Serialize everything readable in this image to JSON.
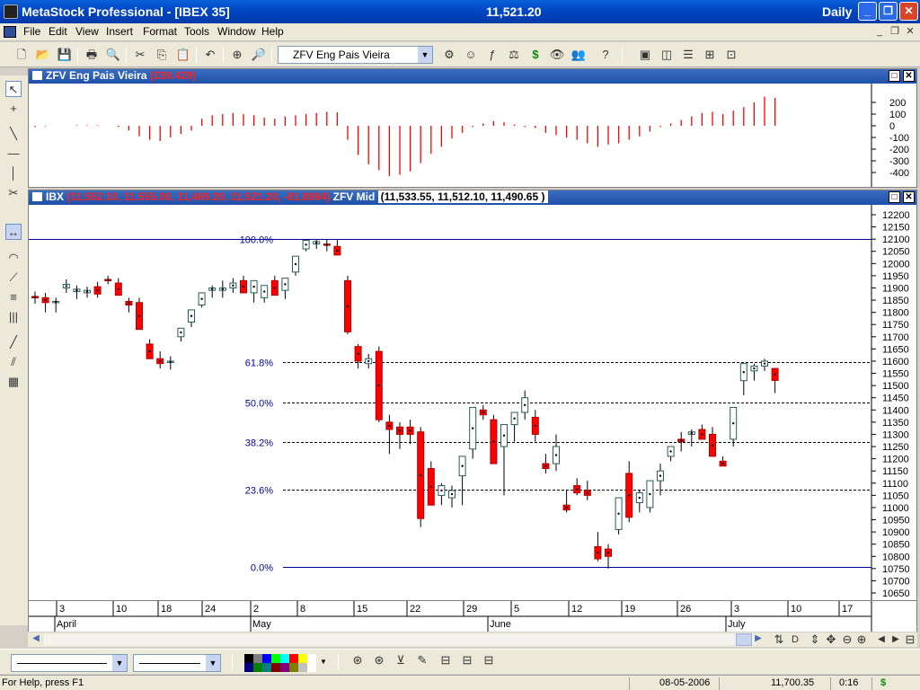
{
  "window": {
    "title": "MetaStock Professional - [IBEX 35]",
    "center_value": "11,521.20",
    "period": "Daily",
    "btn_minimize": "_",
    "btn_restore": "❐",
    "btn_close": "✕"
  },
  "menu": {
    "items": [
      "File",
      "Edit",
      "View",
      "Insert",
      "Format",
      "Tools",
      "Window",
      "Help"
    ],
    "mdi_min": "_",
    "mdi_restore": "❐",
    "mdi_close": "✕"
  },
  "toolbar": {
    "indicator_select": "ZFV Eng Pais Vieira"
  },
  "indicator_pane": {
    "name": "ZFV Eng Pais Vieira",
    "value": "(239.429)",
    "y_ticks": [
      200,
      100,
      0,
      -100,
      -200,
      -300,
      -400
    ],
    "color": "#ff0000"
  },
  "price_pane": {
    "symbol": "IBX",
    "ohlc_text": "(11,552.10, 11,555.00, 11,469.20, 11,521.20, -81.8994)",
    "overlay_name": "ZFV Mid",
    "overlay_values": "(11,533.55, 11,512.10, 11,490.65 )",
    "y_ticks": [
      12200,
      12150,
      12100,
      12050,
      12000,
      11950,
      11900,
      11850,
      11800,
      11750,
      11700,
      11650,
      11600,
      11550,
      11500,
      11450,
      11400,
      11350,
      11300,
      11250,
      11200,
      11150,
      11100,
      11050,
      11000,
      10950,
      10900,
      10850,
      10800,
      10750,
      10700,
      10650
    ],
    "fib_levels": [
      {
        "label": "100.0%",
        "price": 12100,
        "style": "solid"
      },
      {
        "label": "61.8%",
        "price": 11595,
        "style": "dashed"
      },
      {
        "label": "50.0%",
        "price": 11430,
        "style": "dashed"
      },
      {
        "label": "38.2%",
        "price": 11270,
        "style": "dashed"
      },
      {
        "label": "23.6%",
        "price": 11075,
        "style": "dashed"
      },
      {
        "label": "0.0%",
        "price": 10755,
        "style": "solid"
      }
    ],
    "up_color": "#ffffff",
    "down_color": "#ff0000",
    "line_color": "#0000a0"
  },
  "x_axis": {
    "days": [
      "3",
      "10",
      "18",
      "24",
      "2",
      "8",
      "15",
      "22",
      "29",
      "5",
      "12",
      "19",
      "26",
      "3",
      "10",
      "17"
    ],
    "months": [
      "April",
      "May",
      "June",
      "July"
    ]
  },
  "chart_data": {
    "type": "candlestick",
    "series": [
      {
        "name": "IBX",
        "values": [
          [
            11865,
            11885,
            11835,
            11860
          ],
          [
            11860,
            11880,
            11800,
            11840
          ],
          [
            11840,
            11860,
            11800,
            11845
          ],
          [
            11900,
            11935,
            11880,
            11915
          ],
          [
            11885,
            11910,
            11855,
            11895
          ],
          [
            11880,
            11905,
            11860,
            11890
          ],
          [
            11905,
            11925,
            11860,
            11875
          ],
          [
            11935,
            11950,
            11915,
            11930
          ],
          [
            11920,
            11940,
            11880,
            11870
          ],
          [
            11845,
            11860,
            11800,
            11830
          ],
          [
            11840,
            11860,
            11780,
            11730
          ],
          [
            11670,
            11690,
            11610,
            11610
          ],
          [
            11610,
            11640,
            11570,
            11590
          ],
          [
            11595,
            11620,
            11565,
            11600
          ],
          [
            11700,
            11720,
            11680,
            11735
          ],
          [
            11760,
            11790,
            11740,
            11810
          ],
          [
            11830,
            11850,
            11820,
            11880
          ],
          [
            11890,
            11910,
            11860,
            11900
          ],
          [
            11890,
            11930,
            11860,
            11900
          ],
          [
            11900,
            11940,
            11880,
            11920
          ],
          [
            11930,
            11950,
            11890,
            11880
          ],
          [
            11880,
            11900,
            11840,
            11930
          ],
          [
            11860,
            11890,
            11840,
            11910
          ],
          [
            11930,
            11950,
            11880,
            11870
          ],
          [
            11890,
            11910,
            11855,
            11940
          ],
          [
            11965,
            11990,
            11950,
            12030
          ],
          [
            12060,
            12080,
            12050,
            12095
          ],
          [
            12080,
            12100,
            12060,
            12090
          ],
          [
            12080,
            12100,
            12050,
            12075
          ],
          [
            12070,
            12100,
            12040,
            12035
          ],
          [
            11930,
            11950,
            11710,
            11720
          ],
          [
            11660,
            11670,
            11570,
            11600
          ],
          [
            11590,
            11630,
            11570,
            11610
          ],
          [
            11640,
            11660,
            11350,
            11360
          ],
          [
            11350,
            11380,
            11220,
            11320
          ],
          [
            11330,
            11350,
            11240,
            11300
          ],
          [
            11330,
            11360,
            11260,
            11300
          ],
          [
            11310,
            11330,
            10920,
            10955
          ],
          [
            11160,
            11190,
            11010,
            11010
          ],
          [
            11050,
            11100,
            11010,
            11090
          ],
          [
            11040,
            11090,
            11000,
            11070
          ],
          [
            11130,
            11160,
            11010,
            11210
          ],
          [
            11240,
            11270,
            11200,
            11410
          ],
          [
            11400,
            11420,
            11360,
            11380
          ],
          [
            11360,
            11380,
            11200,
            11180
          ],
          [
            11250,
            11300,
            11050,
            11340
          ],
          [
            11340,
            11380,
            11270,
            11390
          ],
          [
            11390,
            11480,
            11360,
            11450
          ],
          [
            11370,
            11400,
            11270,
            11300
          ],
          [
            11180,
            11220,
            11140,
            11160
          ],
          [
            11180,
            11300,
            11150,
            11250
          ],
          [
            11010,
            11070,
            10980,
            10990
          ],
          [
            11090,
            11120,
            11050,
            11060
          ],
          [
            11070,
            11110,
            11030,
            11050
          ],
          [
            10840,
            10900,
            10780,
            10790
          ],
          [
            10830,
            10850,
            10750,
            10800
          ],
          [
            10910,
            10940,
            10890,
            11040
          ],
          [
            11140,
            11190,
            10940,
            10960
          ],
          [
            11020,
            11070,
            10980,
            11060
          ],
          [
            11000,
            11090,
            10980,
            11110
          ],
          [
            11110,
            11180,
            11050,
            11150
          ],
          [
            11210,
            11240,
            11190,
            11250
          ],
          [
            11280,
            11310,
            11230,
            11270
          ],
          [
            11300,
            11320,
            11250,
            11310
          ],
          [
            11320,
            11340,
            11280,
            11280
          ],
          [
            11300,
            11330,
            11210,
            11210
          ],
          [
            11190,
            11210,
            11180,
            11170
          ],
          [
            11280,
            11350,
            11250,
            11410
          ],
          [
            11520,
            11560,
            11460,
            11590
          ],
          [
            11560,
            11590,
            11520,
            11580
          ],
          [
            11580,
            11610,
            11560,
            11600
          ],
          [
            11570,
            11555,
            11469,
            11521
          ]
        ]
      },
      {
        "name": "ZFV Eng Pais Vieira",
        "values": [
          -10,
          -5,
          0,
          0,
          5,
          5,
          5,
          0,
          -10,
          -40,
          -90,
          -120,
          -130,
          -100,
          -70,
          -40,
          60,
          90,
          100,
          110,
          100,
          90,
          70,
          60,
          80,
          90,
          100,
          110,
          120,
          115,
          -120,
          -250,
          -330,
          -380,
          -430,
          -420,
          -390,
          -320,
          -240,
          -180,
          -110,
          -60,
          -10,
          20,
          40,
          30,
          10,
          -10,
          -20,
          -60,
          -80,
          -100,
          -120,
          -150,
          -180,
          -160,
          -150,
          -120,
          -90,
          -50,
          -10,
          20,
          50,
          80,
          110,
          120,
          100,
          130,
          160,
          200,
          250,
          239
        ]
      }
    ]
  },
  "status": {
    "help": "For Help, press F1",
    "date": "08-05-2006",
    "price": "11,700.35",
    "time": "0:16",
    "dollar": "$"
  }
}
